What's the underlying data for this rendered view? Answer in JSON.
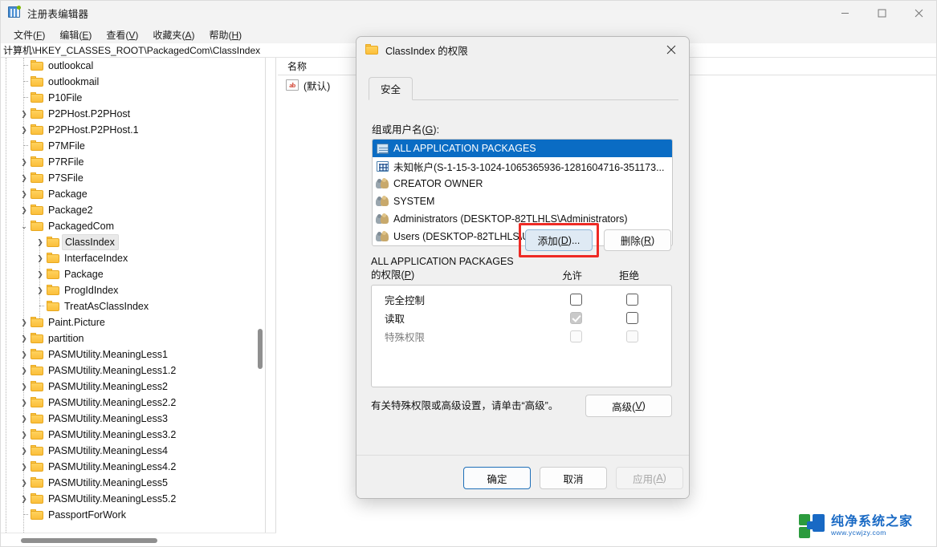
{
  "window": {
    "title": "注册表编辑器",
    "icon": "registry-icon",
    "controls": {
      "minimize": "—",
      "maximize": "□",
      "close": "✕"
    }
  },
  "menubar": {
    "items": [
      {
        "label": "文件",
        "accel": "F"
      },
      {
        "label": "编辑",
        "accel": "E"
      },
      {
        "label": "查看",
        "accel": "V"
      },
      {
        "label": "收藏夹",
        "accel": "A"
      },
      {
        "label": "帮助",
        "accel": "H"
      }
    ]
  },
  "address": {
    "path": "计算机\\HKEY_CLASSES_ROOT\\PackagedCom\\ClassIndex"
  },
  "tree": {
    "items": [
      {
        "label": "outlookcal",
        "indent": 1,
        "expander": "leaf",
        "selected": false
      },
      {
        "label": "outlookmail",
        "indent": 1,
        "expander": "leaf",
        "selected": false
      },
      {
        "label": "P10File",
        "indent": 1,
        "expander": "leaf",
        "selected": false
      },
      {
        "label": "P2PHost.P2PHost",
        "indent": 1,
        "expander": "collapsed",
        "selected": false
      },
      {
        "label": "P2PHost.P2PHost.1",
        "indent": 1,
        "expander": "collapsed",
        "selected": false
      },
      {
        "label": "P7MFile",
        "indent": 1,
        "expander": "leaf",
        "selected": false
      },
      {
        "label": "P7RFile",
        "indent": 1,
        "expander": "collapsed",
        "selected": false
      },
      {
        "label": "P7SFile",
        "indent": 1,
        "expander": "collapsed",
        "selected": false
      },
      {
        "label": "Package",
        "indent": 1,
        "expander": "collapsed",
        "selected": false
      },
      {
        "label": "Package2",
        "indent": 1,
        "expander": "collapsed",
        "selected": false
      },
      {
        "label": "PackagedCom",
        "indent": 1,
        "expander": "expanded",
        "selected": false
      },
      {
        "label": "ClassIndex",
        "indent": 2,
        "expander": "collapsed",
        "selected": true
      },
      {
        "label": "InterfaceIndex",
        "indent": 2,
        "expander": "collapsed",
        "selected": false
      },
      {
        "label": "Package",
        "indent": 2,
        "expander": "collapsed",
        "selected": false
      },
      {
        "label": "ProgIdIndex",
        "indent": 2,
        "expander": "collapsed",
        "selected": false
      },
      {
        "label": "TreatAsClassIndex",
        "indent": 2,
        "expander": "leaf",
        "selected": false
      },
      {
        "label": "Paint.Picture",
        "indent": 1,
        "expander": "collapsed",
        "selected": false
      },
      {
        "label": "partition",
        "indent": 1,
        "expander": "collapsed",
        "selected": false
      },
      {
        "label": "PASMUtility.MeaningLess1",
        "indent": 1,
        "expander": "collapsed",
        "selected": false
      },
      {
        "label": "PASMUtility.MeaningLess1.2",
        "indent": 1,
        "expander": "collapsed",
        "selected": false
      },
      {
        "label": "PASMUtility.MeaningLess2",
        "indent": 1,
        "expander": "collapsed",
        "selected": false
      },
      {
        "label": "PASMUtility.MeaningLess2.2",
        "indent": 1,
        "expander": "collapsed",
        "selected": false
      },
      {
        "label": "PASMUtility.MeaningLess3",
        "indent": 1,
        "expander": "collapsed",
        "selected": false
      },
      {
        "label": "PASMUtility.MeaningLess3.2",
        "indent": 1,
        "expander": "collapsed",
        "selected": false
      },
      {
        "label": "PASMUtility.MeaningLess4",
        "indent": 1,
        "expander": "collapsed",
        "selected": false
      },
      {
        "label": "PASMUtility.MeaningLess4.2",
        "indent": 1,
        "expander": "collapsed",
        "selected": false
      },
      {
        "label": "PASMUtility.MeaningLess5",
        "indent": 1,
        "expander": "collapsed",
        "selected": false
      },
      {
        "label": "PASMUtility.MeaningLess5.2",
        "indent": 1,
        "expander": "collapsed",
        "selected": false
      },
      {
        "label": "PassportForWork",
        "indent": 1,
        "expander": "leaf",
        "selected": false
      }
    ]
  },
  "values": {
    "column_name": "名称",
    "rows": [
      {
        "icon": "string-value-icon",
        "icon_text": "ab",
        "name": "(默认)"
      }
    ]
  },
  "dialog": {
    "title": "ClassIndex 的权限",
    "title_icon": "folder-icon",
    "close_label": "✕",
    "tabs": [
      {
        "label": "安全",
        "active": true
      }
    ],
    "group_label": "组或用户名(G):",
    "group_label_text": "组或用户名(",
    "group_label_accel": "G",
    "group_label_tail": "):",
    "users": [
      {
        "name": "ALL APPLICATION PACKAGES",
        "icon": "package-icon",
        "selected": true
      },
      {
        "name": "未知帐户(S-1-15-3-1024-1065365936-1281604716-351173...",
        "icon": "unknown-account-icon",
        "selected": false
      },
      {
        "name": "CREATOR OWNER",
        "icon": "group-icon",
        "selected": false
      },
      {
        "name": "SYSTEM",
        "icon": "group-icon",
        "selected": false
      },
      {
        "name": "Administrators (DESKTOP-82TLHLS\\Administrators)",
        "icon": "group-icon",
        "selected": false
      },
      {
        "name": "Users (DESKTOP-82TLHLS\\Users)",
        "icon": "group-icon",
        "selected": false
      }
    ],
    "buttons": {
      "add": {
        "text": "添加(",
        "accel": "D",
        "tail": ")..."
      },
      "remove": {
        "text": "删除(",
        "accel": "R",
        "tail": ")"
      },
      "advanced": {
        "text": "高级(",
        "accel": "V",
        "tail": ")"
      },
      "ok": {
        "text": "确定"
      },
      "cancel": {
        "text": "取消"
      },
      "apply": {
        "text": "应用(",
        "accel": "A",
        "tail": ")"
      }
    },
    "permissions_label_line1": "ALL APPLICATION PACKAGES",
    "permissions_label_line2_head": "的权限(",
    "permissions_label_line2_accel": "P",
    "permissions_label_line2_tail": ")",
    "columns": {
      "allow": "允许",
      "deny": "拒绝"
    },
    "permissions": [
      {
        "name": "完全控制",
        "allow": "unchecked",
        "deny": "unchecked",
        "dim": false
      },
      {
        "name": "读取",
        "allow": "checked-dim",
        "deny": "unchecked",
        "dim": false
      },
      {
        "name": "特殊权限",
        "allow": "dim",
        "deny": "dim",
        "dim": true
      }
    ],
    "advanced_hint": "有关特殊权限或高级设置，请单击“高级”。"
  },
  "watermark": {
    "name": "纯净系统之家",
    "url": "www.ycwjzy.com"
  },
  "colors": {
    "selection_blue": "#0a6cc4",
    "accent_blue": "#1e6fb8",
    "highlight_red": "#ee2a24",
    "dialog_bg": "#f0f0f0",
    "folder_yellow": "#fbbf3b"
  }
}
